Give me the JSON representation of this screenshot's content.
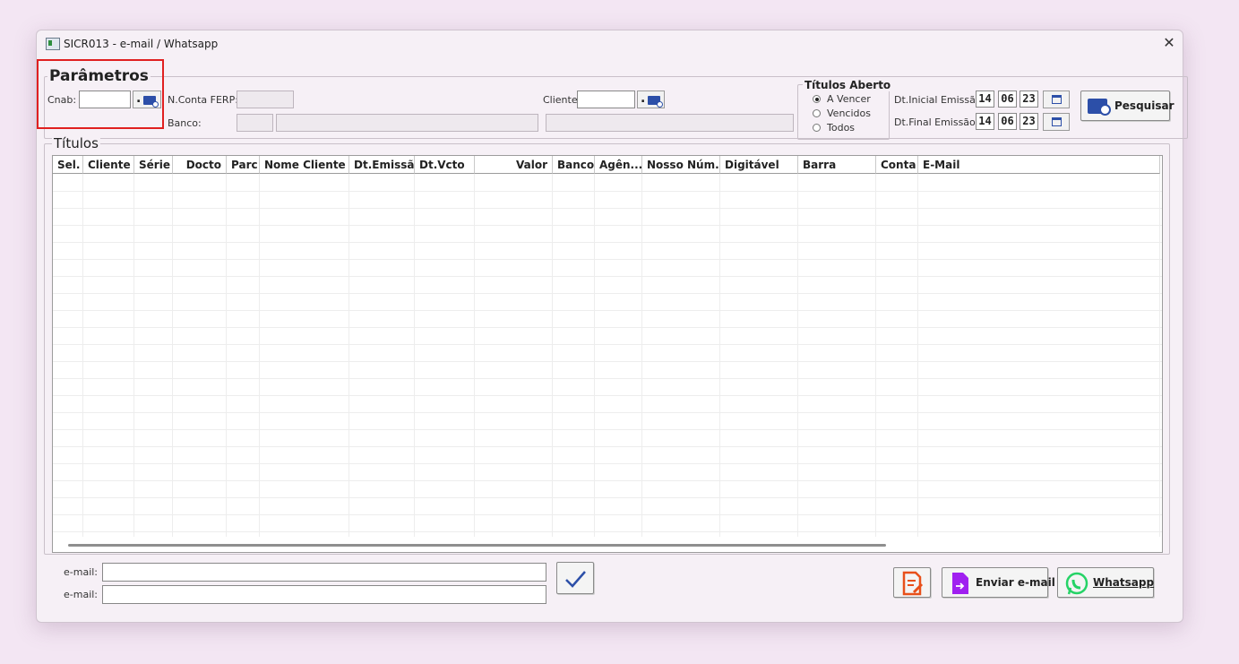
{
  "window": {
    "title": "SICR013 - e-mail / Whatsapp",
    "close_glyph": "✕"
  },
  "parametros": {
    "legend": "Parâmetros",
    "cnab_label": "Cnab:",
    "cnab_value": "",
    "nconta_label": "N.Conta FERP:",
    "banco_label": "Banco:",
    "cliente_label": "Cliente:",
    "cliente_value": ""
  },
  "titulos_aberto": {
    "legend": "Títulos Aberto",
    "options": [
      {
        "label": "A Vencer",
        "selected": true
      },
      {
        "label": "Vencidos",
        "selected": false
      },
      {
        "label": "Todos",
        "selected": false
      }
    ]
  },
  "dates": {
    "inicial_label": "Dt.Inicial Emissão:",
    "inicial": {
      "day": "14",
      "month": "06",
      "year": "23"
    },
    "final_label": "Dt.Final Emissão:",
    "final": {
      "day": "14",
      "month": "06",
      "year": "23"
    }
  },
  "pesquisar_label": "Pesquisar",
  "titulos": {
    "legend": "Títulos",
    "columns": [
      "Sel.",
      "Cliente",
      "Série",
      "Docto",
      "Parc",
      "Nome Cliente",
      "Dt.Emissão",
      "Dt.Vcto",
      "Valor",
      "Banco",
      "Agên...",
      "Nosso Núm...",
      "Digitável",
      "Barra",
      "Conta",
      "E-Mail"
    ]
  },
  "email": {
    "label1": "e-mail:",
    "value1": "",
    "label2": "e-mail:",
    "value2": ""
  },
  "actions": {
    "enviar_email_label": "Enviar e-mail",
    "whatsapp_label": "Whatsapp"
  },
  "colors": {
    "accent": "#2c4fa8",
    "highlight_box": "#e02020",
    "whatsapp_green": "#25d366",
    "email_purple": "#a020f0",
    "edit_orange": "#e8501a"
  }
}
